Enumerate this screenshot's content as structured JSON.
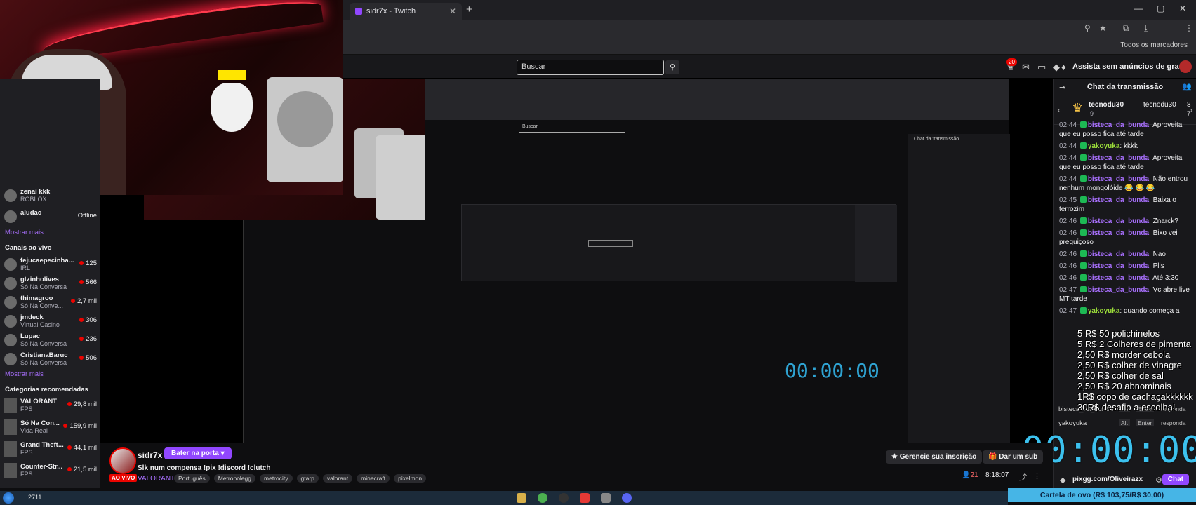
{
  "browser": {
    "tab_title": "sidr7x - Twitch",
    "bookmarks_label": "Todos os marcadores"
  },
  "topnav": {
    "search_placeholder": "Buscar",
    "notif_count": "20",
    "prime_label": "Assista sem anúncios de graça"
  },
  "sidebar": {
    "partial_top_name": "zenai kkk",
    "partial_top_sub": "ROBLOX",
    "offline_name": "aludac",
    "offline_status": "Offline",
    "show_more": "Mostrar mais",
    "live_header": "Canais ao vivo",
    "live_channels": [
      {
        "name": "fejucaepecinha...",
        "sub": "IRL",
        "viewers": "125"
      },
      {
        "name": "gtzinholives",
        "sub": "Só Na Conversa",
        "viewers": "566"
      },
      {
        "name": "thimagroo",
        "sub": "Só Na Conve...",
        "viewers": "2,7 mil"
      },
      {
        "name": "jmdeck",
        "sub": "Virtual Casino",
        "viewers": "306"
      },
      {
        "name": "Lupac",
        "sub": "Só Na Conversa",
        "viewers": "236"
      },
      {
        "name": "CristianaBaruc",
        "sub": "Só Na Conversa",
        "viewers": "506"
      }
    ],
    "show_more_2": "Mostrar mais",
    "categories_header": "Categorias recomendadas",
    "categories": [
      {
        "name": "VALORANT",
        "sub": "FPS",
        "viewers": "29,8 mil"
      },
      {
        "name": "Só Na Con...",
        "sub": "Vida Real",
        "viewers": "159,9 mil"
      },
      {
        "name": "Grand Theft...",
        "sub": "FPS",
        "viewers": "44,1 mil"
      },
      {
        "name": "Counter-Str...",
        "sub": "FPS",
        "viewers": "21,5 mil"
      }
    ]
  },
  "chat": {
    "header": "Chat da transmissão",
    "gift": {
      "name1": "tecnodu30",
      "count1": "9",
      "name2": "tecnodu30",
      "n2": "8",
      "c2": "7"
    },
    "messages": [
      {
        "ts": "02:44",
        "user": "bisteca_da_bunda",
        "ucls": "u1",
        "text": ": Aproveita que eu posso fica até tarde"
      },
      {
        "ts": "02:44",
        "user": "yakoyuka",
        "ucls": "u2",
        "text": ": kkkk"
      },
      {
        "ts": "02:44",
        "user": "bisteca_da_bunda",
        "ucls": "u1",
        "text": ": Aproveita que eu posso fica até tarde"
      },
      {
        "ts": "02:44",
        "user": "bisteca_da_bunda",
        "ucls": "u1",
        "text": ": Não entrou nenhum mongolóide 😂 😂 😂"
      },
      {
        "ts": "02:45",
        "user": "bisteca_da_bunda",
        "ucls": "u1",
        "text": ": Baixa o terrozim"
      },
      {
        "ts": "02:46",
        "user": "bisteca_da_bunda",
        "ucls": "u1",
        "text": ": Znarck?"
      },
      {
        "ts": "02:46",
        "user": "bisteca_da_bunda",
        "ucls": "u1",
        "text": ": Bixo vei preguiçoso"
      },
      {
        "ts": "02:46",
        "user": "bisteca_da_bunda",
        "ucls": "u1",
        "text": ": Nao"
      },
      {
        "ts": "02:46",
        "user": "bisteca_da_bunda",
        "ucls": "u1",
        "text": ": Plis"
      },
      {
        "ts": "02:46",
        "user": "bisteca_da_bunda",
        "ucls": "u1",
        "text": ": Até 3:30"
      },
      {
        "ts": "02:47",
        "user": "bisteca_da_bunda",
        "ucls": "u1",
        "text": ": Vc abre live MT tarde"
      },
      {
        "ts": "02:47",
        "user": "yakoyuka",
        "ucls": "u2",
        "text": ": quando começa a"
      }
    ],
    "mention_rows": [
      {
        "name": "bisteca_da_bunda",
        "alt": "Alt",
        "enter": "Enter",
        "resp": "responda"
      },
      {
        "name": "yakoyuka",
        "alt": "Alt",
        "enter": "Enter",
        "resp": "responda"
      }
    ],
    "pix": "pixgg.com/Oliveirazx",
    "chat_button": "Chat"
  },
  "overlay": {
    "items": [
      "5 R$ 50 polichinelos",
      "5 R$ 2 Colheres de pimenta",
      "2,50 R$   morder cebola",
      "2,50 R$ colher de vinagre",
      "2,50 R$ colher de sal",
      "2,50 R$  20 abnominais",
      "1R$  copo de cachaçakkkkkk",
      "30R$ desafio a escolha!"
    ],
    "timer": "00:00:00",
    "cartela": "Cartela de ovo (R$ 103,75/R$ 30,00)"
  },
  "stream": {
    "streamer": "sidr7x",
    "knock_label": "Bater na porta",
    "live_label": "AO VIVO",
    "title": "Slk num compensa !pix !discord !clutch",
    "game": "VALORANT",
    "tags": [
      "Português",
      "Metropolegg",
      "metrocity",
      "gtarp",
      "valorant",
      "minecraft",
      "pixelmon"
    ],
    "sub_label": "Gerencie sua inscrição",
    "give_label": "Dar um sub",
    "viewers": "21",
    "uptime": "8:18:07"
  },
  "taskbar": {
    "number": "2711"
  },
  "colors": {
    "accent": "#9147ff",
    "live": "#eb0400",
    "timer": "#3cc1ee"
  }
}
